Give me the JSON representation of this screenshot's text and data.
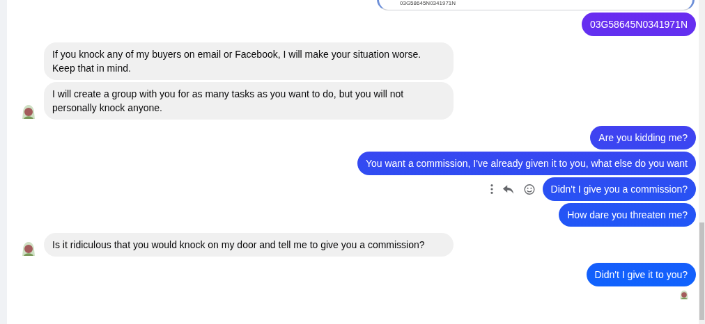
{
  "shared_card": {
    "code": "03G58645N0341971N"
  },
  "messages": [
    {
      "kind": "outgoing",
      "text": "03G58645N0341971N",
      "avatar": false,
      "actions": false
    },
    {
      "kind": "incoming",
      "text": "If you knock any of my buyers on email or Facebook, I will make your situation worse. Keep that in mind.",
      "avatar": false,
      "actions": false
    },
    {
      "kind": "incoming",
      "text": "I will create a group with you for as many tasks as you want to do, but you will not personally knock anyone.",
      "avatar": true,
      "actions": false
    },
    {
      "kind": "outgoing",
      "text": "Are you kidding me?",
      "avatar": false,
      "actions": false
    },
    {
      "kind": "outgoing",
      "text": "You want a commission, I've already given it to you, what else do you want",
      "avatar": false,
      "actions": false
    },
    {
      "kind": "outgoing",
      "text": "Didn't I give you a commission?",
      "avatar": false,
      "actions": true
    },
    {
      "kind": "outgoing",
      "text": "How dare you threaten me?",
      "avatar": false,
      "actions": false
    },
    {
      "kind": "incoming",
      "text": "Is it ridiculous that you would knock on my door and tell me to give you a commission?",
      "avatar": true,
      "actions": false
    },
    {
      "kind": "outgoing",
      "text": "Didn't I give it to you?",
      "avatar": false,
      "actions": false
    }
  ],
  "seen": true
}
